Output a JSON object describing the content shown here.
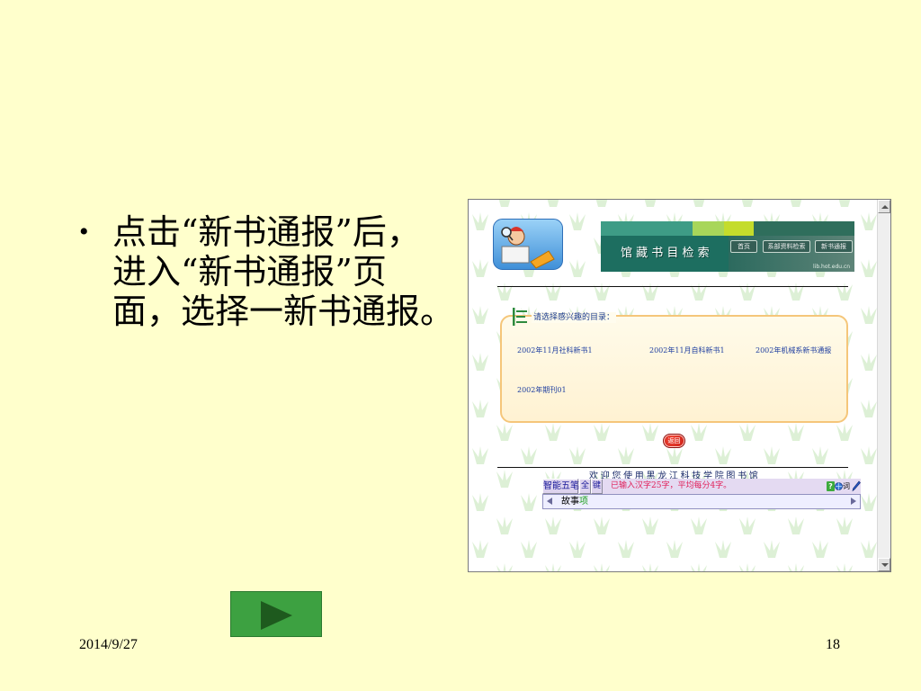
{
  "slide": {
    "bullet_symbol": "•",
    "bullet_lines": [
      "点击“新书通报”后，",
      "进入“新书通报”页",
      "面，选择一新书通报。"
    ],
    "date": "2014/9/27",
    "page_number": "18"
  },
  "screenshot": {
    "banner": {
      "title": "馆 藏 书 目 检 索",
      "nav_buttons": [
        "首页",
        "系部资料检索",
        "新书通报"
      ],
      "site_url": "lib.hot.edu.cn"
    },
    "catalog": {
      "heading": "请选择感兴趣的目录：",
      "links": [
        "2002年11月社科新书1",
        "2002年11月自科新书1",
        "2002年机械系新书通报",
        "2002年期刊01"
      ]
    },
    "back_button": "返回",
    "marquee": "欢迎您使用黑龙江科技学院图书馆",
    "ime": {
      "name": "智能五笔",
      "width_mode": "全",
      "key_mode": "键",
      "status": "已输入汉字25字，平均每分4字。",
      "help": "?",
      "lexicon": "词",
      "candidate_main": "故事",
      "candidate_next": "项"
    }
  },
  "icons": {
    "logo": "library-mascot-logo",
    "catalog_heading": "book-lines-icon",
    "ime_globe": "globe-icon",
    "ime_pen": "pen-icon",
    "next_button": "play-icon"
  },
  "colors": {
    "slide_background": "#FFFFCC",
    "next_button": "#3DA141",
    "banner": "#1D6E60",
    "link": "#1F3FA0",
    "ime_status": "#E0205A",
    "catalog_border": "#F5C67A"
  }
}
